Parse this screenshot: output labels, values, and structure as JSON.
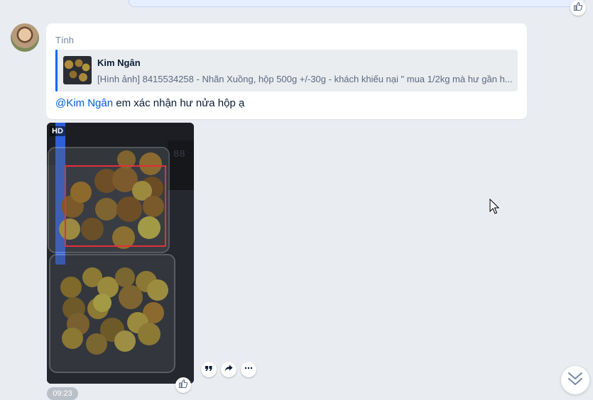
{
  "previous_message": {
    "icon": "thumb-up-icon"
  },
  "message": {
    "sender": "Tính",
    "quote": {
      "name": "Kim Ngân",
      "text": "[Hình ảnh] 8415534258 - Nhãn Xuồng, hộp 500g +/-30g - khách khiếu nại \" mua 1/2kg mà hư gần h..."
    },
    "mention": "@Kim Ngân",
    "text": " em xác nhận hư nửa hộp ạ"
  },
  "photo": {
    "badge": "HD",
    "icon": "thumb-up-icon",
    "time": "09:23"
  },
  "actions": {
    "quote_icon": "quote-icon",
    "share_icon": "share-icon",
    "more_icon": "more-icon"
  },
  "scroll": {
    "icon": "double-chevron-down-icon"
  },
  "colors": {
    "background": "#e9ecf0",
    "accent": "#0068ff",
    "mention": "#005ae0",
    "highlight_box": "#e0303c"
  }
}
